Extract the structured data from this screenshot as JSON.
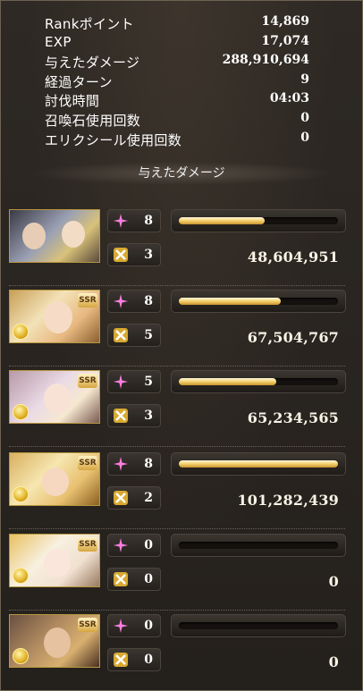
{
  "stats": [
    {
      "label": "Rankポイント",
      "value": "14,869"
    },
    {
      "label": "EXP",
      "value": "17,074"
    },
    {
      "label": "与えたダメージ",
      "value": "288,910,694"
    },
    {
      "label": "経過ターン",
      "value": "9"
    },
    {
      "label": "討伐時間",
      "value": "04:03"
    },
    {
      "label": "召喚石使用回数",
      "value": "0"
    },
    {
      "label": "エリクシール使用回数",
      "value": "0"
    }
  ],
  "section_header": "与えたダメージ",
  "characters": [
    {
      "name": "main-character",
      "ssr": false,
      "ability_count": "8",
      "ougi_count": "3",
      "charge_bar_percent": 54,
      "damage": "48,604,951"
    },
    {
      "name": "character-2",
      "ssr": true,
      "ssr_label": "SSR",
      "ability_count": "8",
      "ougi_count": "5",
      "charge_bar_percent": 64,
      "damage": "67,504,767"
    },
    {
      "name": "character-3",
      "ssr": true,
      "ssr_label": "SSR",
      "ability_count": "5",
      "ougi_count": "3",
      "charge_bar_percent": 61,
      "damage": "65,234,565"
    },
    {
      "name": "character-4",
      "ssr": true,
      "ssr_label": "SSR",
      "ability_count": "8",
      "ougi_count": "2",
      "charge_bar_percent": 100,
      "damage": "101,282,439"
    },
    {
      "name": "character-5",
      "ssr": true,
      "ssr_label": "SSR",
      "ability_count": "0",
      "ougi_count": "0",
      "charge_bar_percent": 0,
      "damage": "0"
    },
    {
      "name": "character-6",
      "ssr": true,
      "ssr_label": "SSR",
      "ability_count": "0",
      "ougi_count": "0",
      "charge_bar_percent": 0,
      "damage": "0"
    }
  ],
  "icons": {
    "ability": "pink-sparkle-icon",
    "ougi": "crossed-swords-icon",
    "element": "light-element-icon"
  },
  "colors": {
    "bar_fill": "#f3cf6a",
    "ability_icon": "#ff7fe0",
    "frame_gold": "#b7963e"
  }
}
